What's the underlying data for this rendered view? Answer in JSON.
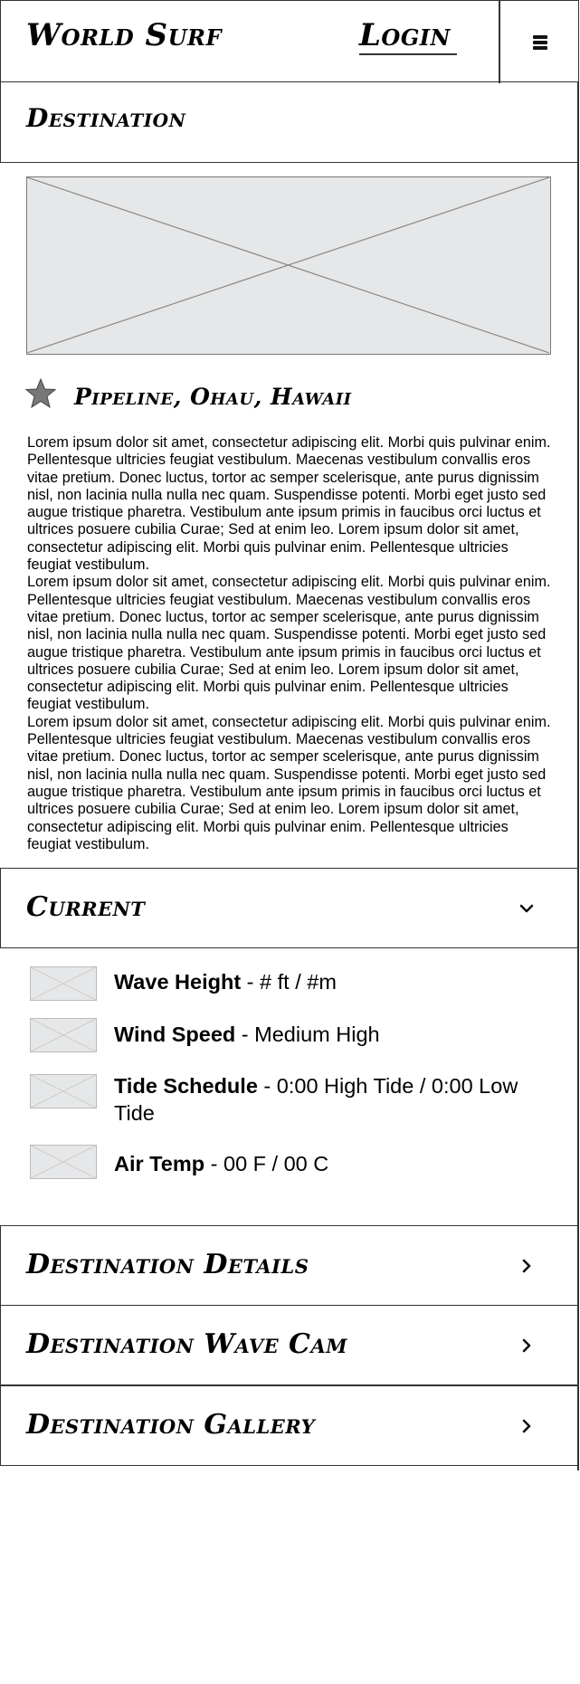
{
  "header": {
    "brand": "World Surf",
    "login_label": "Login",
    "menu_icon": "hamburger-icon"
  },
  "destination_bar": {
    "label": "Destination"
  },
  "hero": {
    "icon": "image-placeholder-icon"
  },
  "location": {
    "title": "Pipeline, Ohau, Hawaii",
    "favorite_icon": "star-icon",
    "favorite_color": "#777777"
  },
  "body": {
    "paragraphs": [
      "Lorem ipsum dolor sit amet, consectetur adipiscing elit. Morbi quis pulvinar enim. Pellentesque ultricies feugiat vestibulum. Maecenas vestibulum convallis eros vitae pretium. Donec luctus, tortor ac semper scelerisque, ante purus dignissim nisl, non lacinia nulla nulla nec quam. Suspendisse potenti. Morbi eget justo sed augue tristique pharetra. Vestibulum ante ipsum primis in faucibus orci luctus et ultrices posuere cubilia Curae; Sed at enim leo. Lorem ipsum dolor sit amet, consectetur adipiscing elit. Morbi quis pulvinar enim. Pellentesque ultricies feugiat vestibulum.",
      "Lorem ipsum dolor sit amet, consectetur adipiscing elit. Morbi quis pulvinar enim. Pellentesque ultricies feugiat vestibulum. Maecenas vestibulum convallis eros vitae pretium. Donec luctus, tortor ac semper scelerisque, ante purus dignissim nisl, non lacinia nulla nulla nec quam. Suspendisse potenti. Morbi eget justo sed augue tristique pharetra. Vestibulum ante ipsum primis in faucibus orci luctus et ultrices posuere cubilia Curae; Sed at enim leo. Lorem ipsum dolor sit amet, consectetur adipiscing elit. Morbi quis pulvinar enim. Pellentesque ultricies feugiat vestibulum.",
      "Lorem ipsum dolor sit amet, consectetur adipiscing elit. Morbi quis pulvinar enim. Pellentesque ultricies feugiat vestibulum. Maecenas vestibulum convallis eros vitae pretium. Donec luctus, tortor ac semper scelerisque, ante purus dignissim nisl, non lacinia nulla nulla nec quam. Suspendisse potenti. Morbi eget justo sed augue tristique pharetra. Vestibulum ante ipsum primis in faucibus orci luctus et ultrices posuere cubilia Curae; Sed at enim leo. Lorem ipsum dolor sit amet, consectetur adipiscing elit. Morbi quis pulvinar enim. Pellentesque ultricies feugiat vestibulum."
    ]
  },
  "current": {
    "title": "Current",
    "toggle_icon": "chevron-down-icon",
    "conditions": [
      {
        "label": "Wave Height",
        "value": " - # ft / #m",
        "icon": "image-placeholder-icon"
      },
      {
        "label": "Wind Speed",
        "value": " - Medium High",
        "icon": "image-placeholder-icon"
      },
      {
        "label": "Tide Schedule",
        "value": " - 0:00 High Tide / 0:00 Low Tide",
        "icon": "image-placeholder-icon"
      },
      {
        "label": "Air Temp",
        "value": " - 00 F / 00 C",
        "icon": "image-placeholder-icon"
      }
    ]
  },
  "sections": [
    {
      "title": "Destination Details",
      "icon": "chevron-right-icon"
    },
    {
      "title": "Destination Wave Cam",
      "icon": "chevron-right-icon"
    },
    {
      "title": "Destination Gallery",
      "icon": "chevron-right-icon"
    }
  ],
  "colors": {
    "placeholder_fill": "#e6e7e8",
    "outline": "#333333"
  }
}
